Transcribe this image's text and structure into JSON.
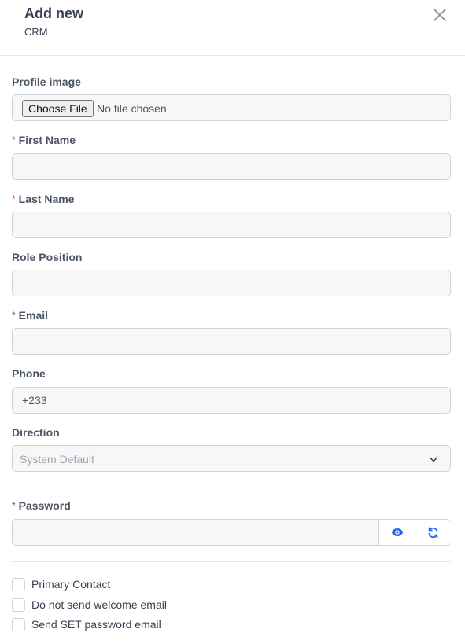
{
  "header": {
    "title": "Add new",
    "subtitle": "CRM",
    "close_icon": "close-icon"
  },
  "form": {
    "profile_image": {
      "label": "Profile image",
      "button_label": "Choose File",
      "status": "No file chosen"
    },
    "first_name": {
      "label": "First Name",
      "required": true,
      "value": ""
    },
    "last_name": {
      "label": "Last Name",
      "required": true,
      "value": ""
    },
    "role_position": {
      "label": "Role Position",
      "required": false,
      "value": ""
    },
    "email": {
      "label": "Email",
      "required": true,
      "value": ""
    },
    "phone": {
      "label": "Phone",
      "required": false,
      "value": "+233"
    },
    "direction": {
      "label": "Direction",
      "selected": "System Default",
      "icon": "chevron-down-icon"
    },
    "password": {
      "label": "Password",
      "required": true,
      "value": "",
      "show_icon": "eye-icon",
      "generate_icon": "refresh-icon"
    },
    "required_marker": "*",
    "checkboxes": [
      {
        "label": "Primary Contact",
        "checked": false
      },
      {
        "label": "Do not send welcome email",
        "checked": false
      },
      {
        "label": "Send SET password email",
        "checked": false
      }
    ]
  },
  "colors": {
    "required": "#e11d48",
    "icon_accent": "#2563eb",
    "input_background": "#f7f7f8",
    "border": "#d1d5db"
  }
}
